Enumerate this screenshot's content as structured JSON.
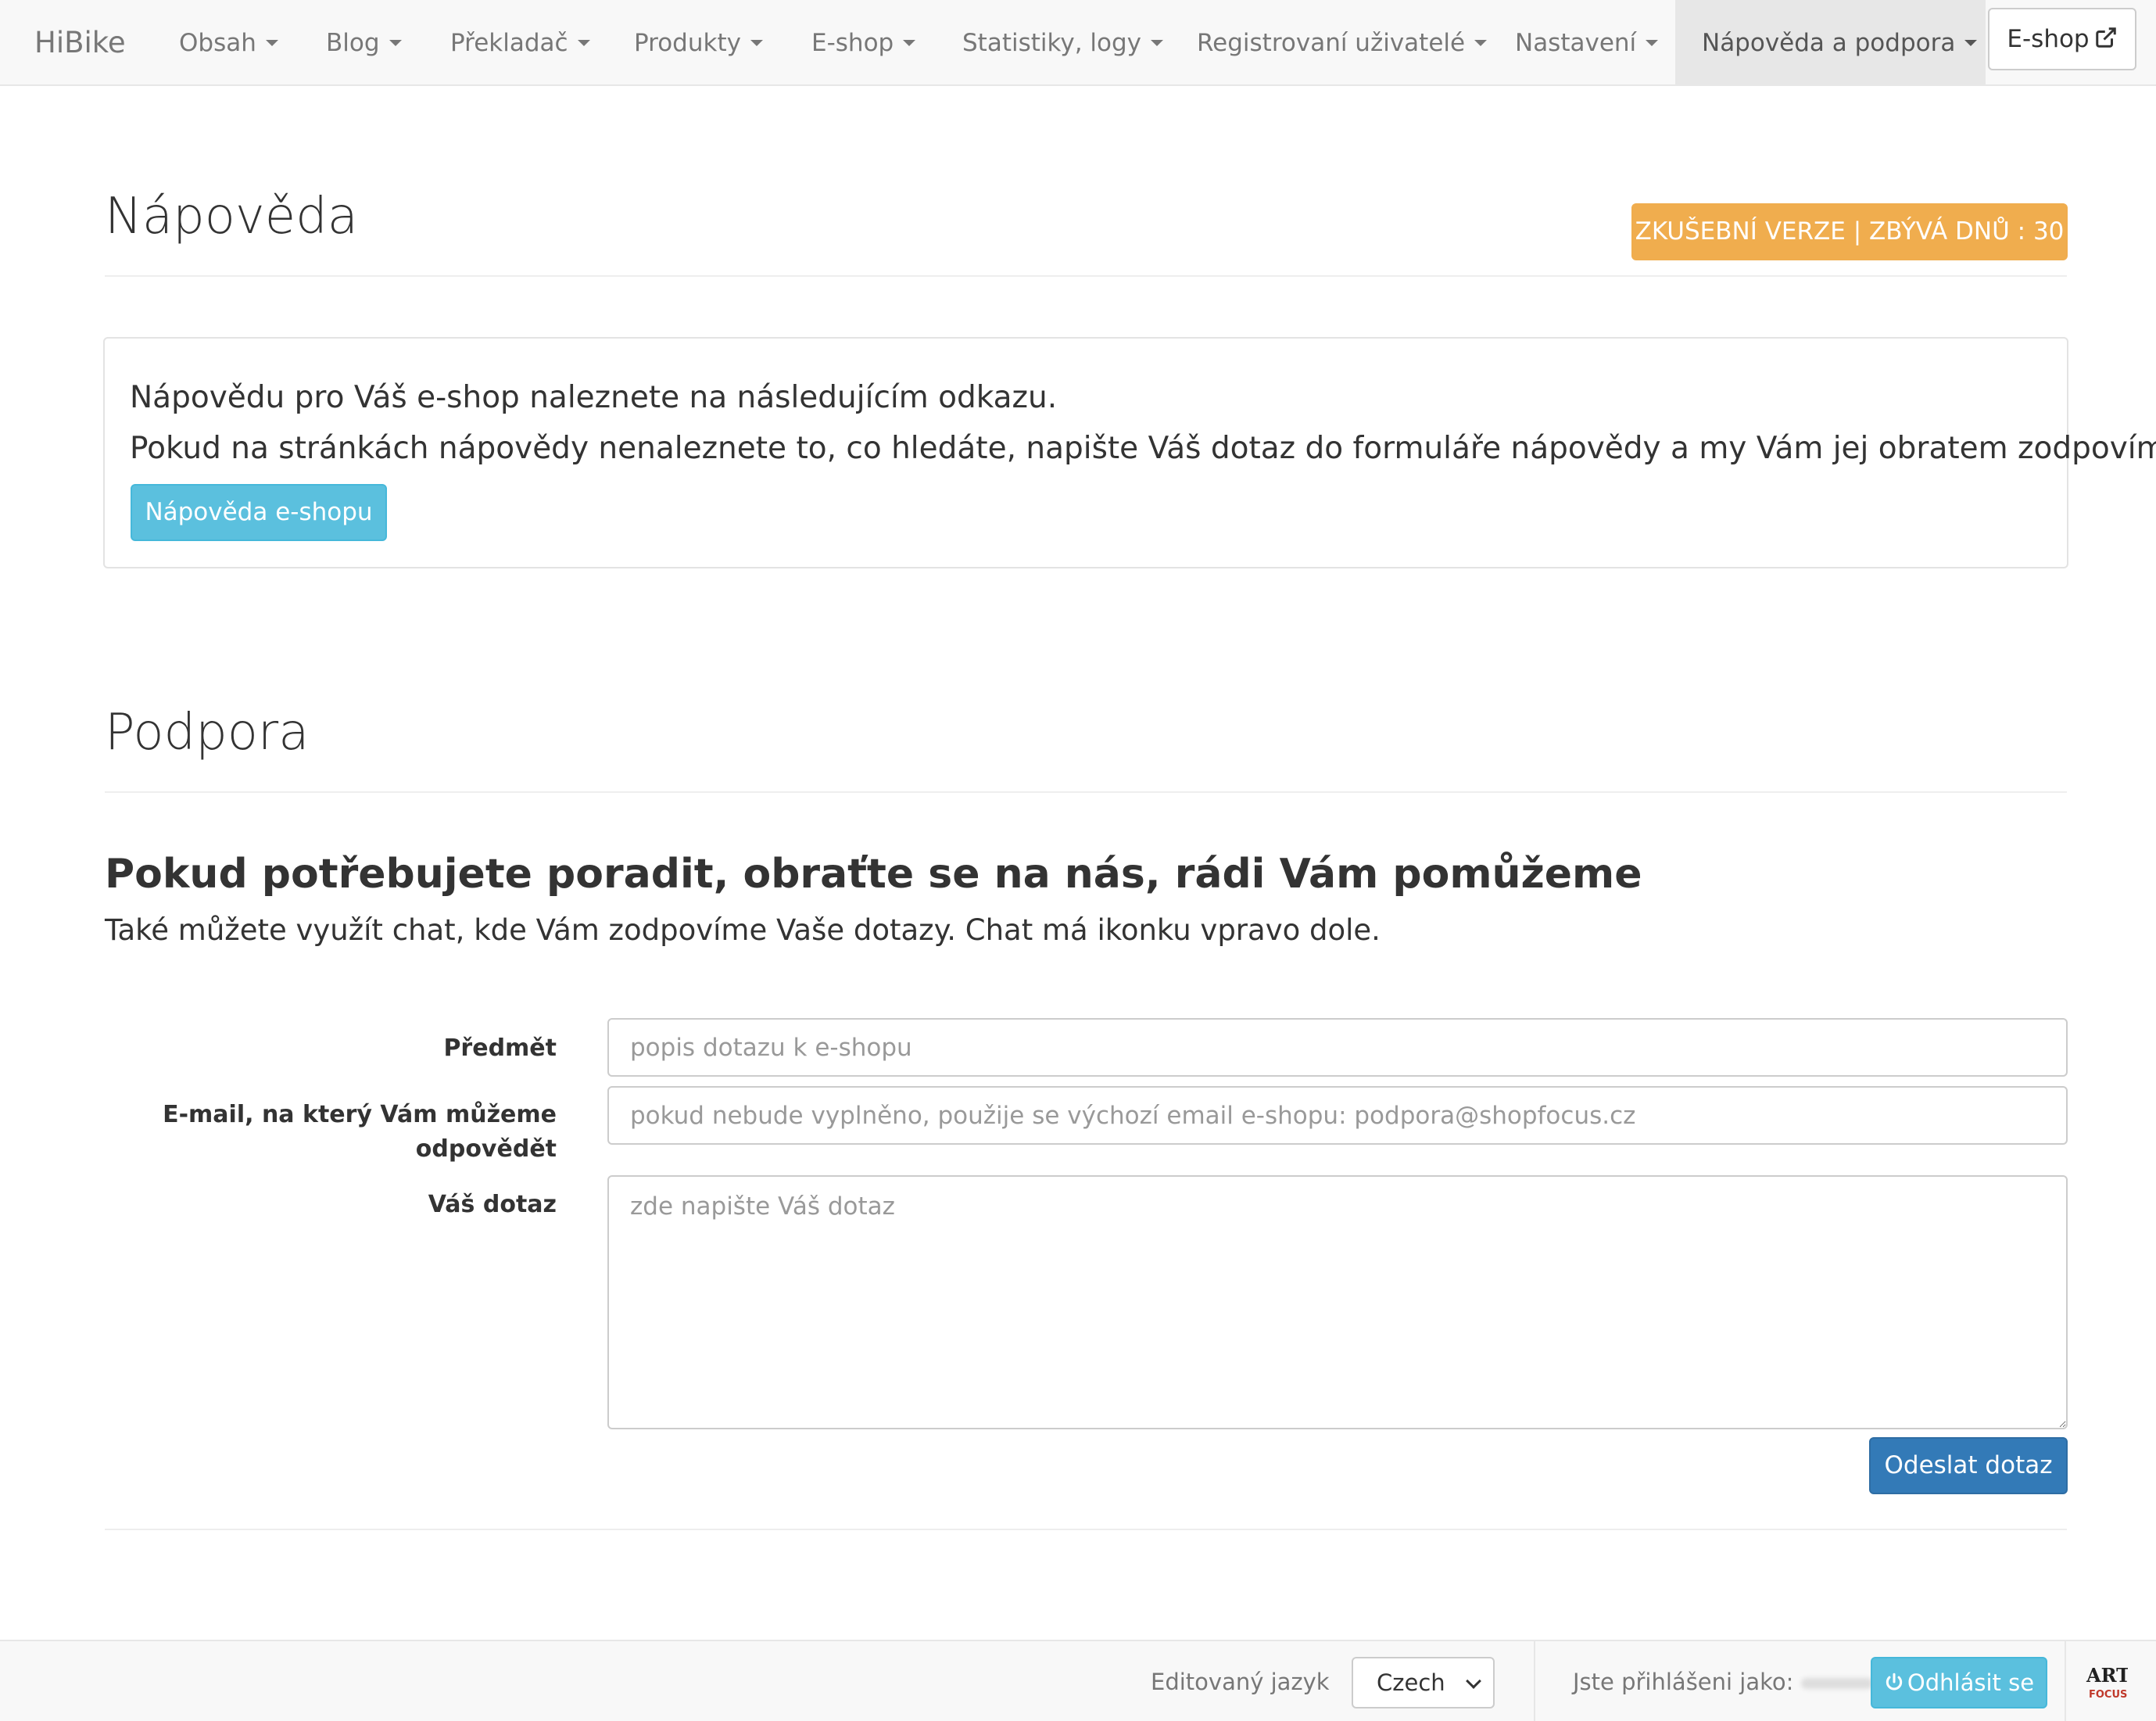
{
  "navbar": {
    "brand": "HiBike",
    "items": [
      {
        "label": "Obsah"
      },
      {
        "label": "Blog"
      },
      {
        "label": "Překladač"
      },
      {
        "label": "Produkty"
      },
      {
        "label": "E-shop"
      },
      {
        "label": "Statistiky, logy"
      },
      {
        "label": "Registrovaní uživatelé"
      },
      {
        "label": "Nastavení"
      },
      {
        "label": "Nápověda a podpora"
      }
    ],
    "active_item": "Nápověda a podpora",
    "eshop_button": "E-shop",
    "eshop_button_icon": "external-link-icon"
  },
  "help": {
    "title": "Nápověda",
    "trial_badge": "ZKUŠEBNÍ VERZE | ZBÝVÁ DNŮ : 30",
    "trial_badge_color": "#f0ad4e",
    "line1": "Nápovědu pro Váš e-shop naleznete na následujícím odkazu.",
    "line2": "Pokud na stránkách nápovědy nenaleznete to, co hledáte, napište Váš dotaz do formuláře nápovědy a my Vám jej obratem zodpovíme.",
    "button": "Nápověda e-shopu"
  },
  "support": {
    "title": "Podpora",
    "lead": "Pokud potřebujete poradit, obraťte se na nás, rádi Vám pomůžeme",
    "sub": "Také můžete využít chat, kde Vám zodpovíme Vaše dotazy. Chat má ikonku vpravo dole.",
    "form": {
      "subject_label": "Předmět",
      "subject_placeholder": "popis dotazu k e-shopu",
      "email_label_line1": "E-mail, na který Vám můžeme",
      "email_label_line2": "odpovědět",
      "email_placeholder": "pokud nebude vyplněno, použije se výchozí email e-shopu: podpora@shopfocus.cz",
      "question_label": "Váš dotaz",
      "question_placeholder": "zde napište Váš dotaz",
      "submit": "Odeslat dotaz"
    }
  },
  "footer": {
    "edited_language_label": "Editovaný jazyk",
    "language_selected": "Czech",
    "logged_in_label": "Jste přihlášeni jako:",
    "logout_button": "Odhlásit se",
    "logout_icon": "power-icon",
    "logo_text_top": "ART",
    "logo_text_bottom": "FOCUS"
  },
  "colors": {
    "primary": "#337ab7",
    "info": "#5bc0de",
    "warning": "#f0ad4e",
    "navbar_bg": "#f8f8f8"
  }
}
